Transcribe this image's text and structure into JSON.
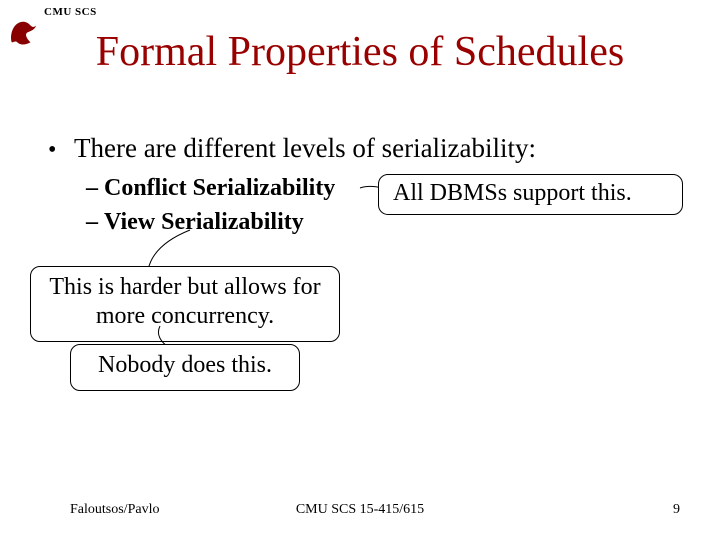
{
  "header": {
    "label": "CMU SCS"
  },
  "title": "Formal Properties of Schedules",
  "body": {
    "bullet": "There are different levels of serializability:",
    "sub1": "Conflict Serializability",
    "sub2": "View Serializability"
  },
  "annotations": {
    "a1": "All DBMSs support this.",
    "a2": "This is harder but allows for more concurrency.",
    "a3": "Nobody does this."
  },
  "footer": {
    "left": "Faloutsos/Pavlo",
    "center": "CMU SCS 15-415/615",
    "right": "9"
  }
}
